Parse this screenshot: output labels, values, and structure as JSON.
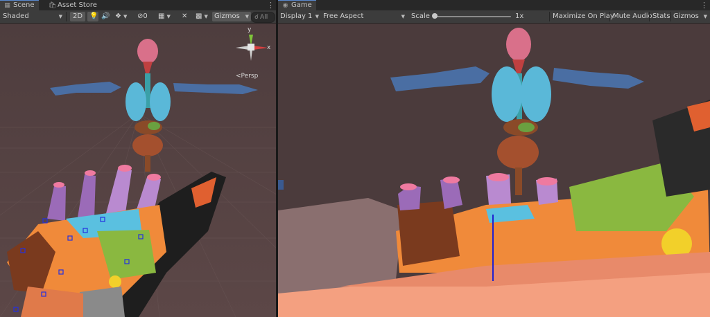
{
  "scene": {
    "tab_title": "Scene",
    "tab_icon": "grid-icon",
    "second_tab_title": "Asset Store",
    "second_tab_icon": "store-bag-icon",
    "toolbar": {
      "shading_mode": "Shaded",
      "toggle_2d": "2D",
      "hidden_count": "0",
      "gizmos_label": "Gizmos",
      "search_placeholder": "All"
    },
    "orientation_axis_x": "x",
    "orientation_axis_y": "y",
    "projection_label": "Persp"
  },
  "game": {
    "tab_title": "Game",
    "tab_icon": "gamepad-icon",
    "toolbar": {
      "display": "Display 1",
      "aspect": "Free Aspect",
      "scale_label": "Scale",
      "scale_value": "1x",
      "maximize_label": "Maximize On Play",
      "mute_label": "Mute Audio",
      "stats_label": "Stats",
      "gizmos_label": "Gizmos"
    }
  },
  "colors": {
    "editor_bg": "#3c3c3c",
    "tab_bar": "#282828",
    "active_tab_accent": "#5a8ad0",
    "viewport_bg": "#4b3c3d"
  }
}
